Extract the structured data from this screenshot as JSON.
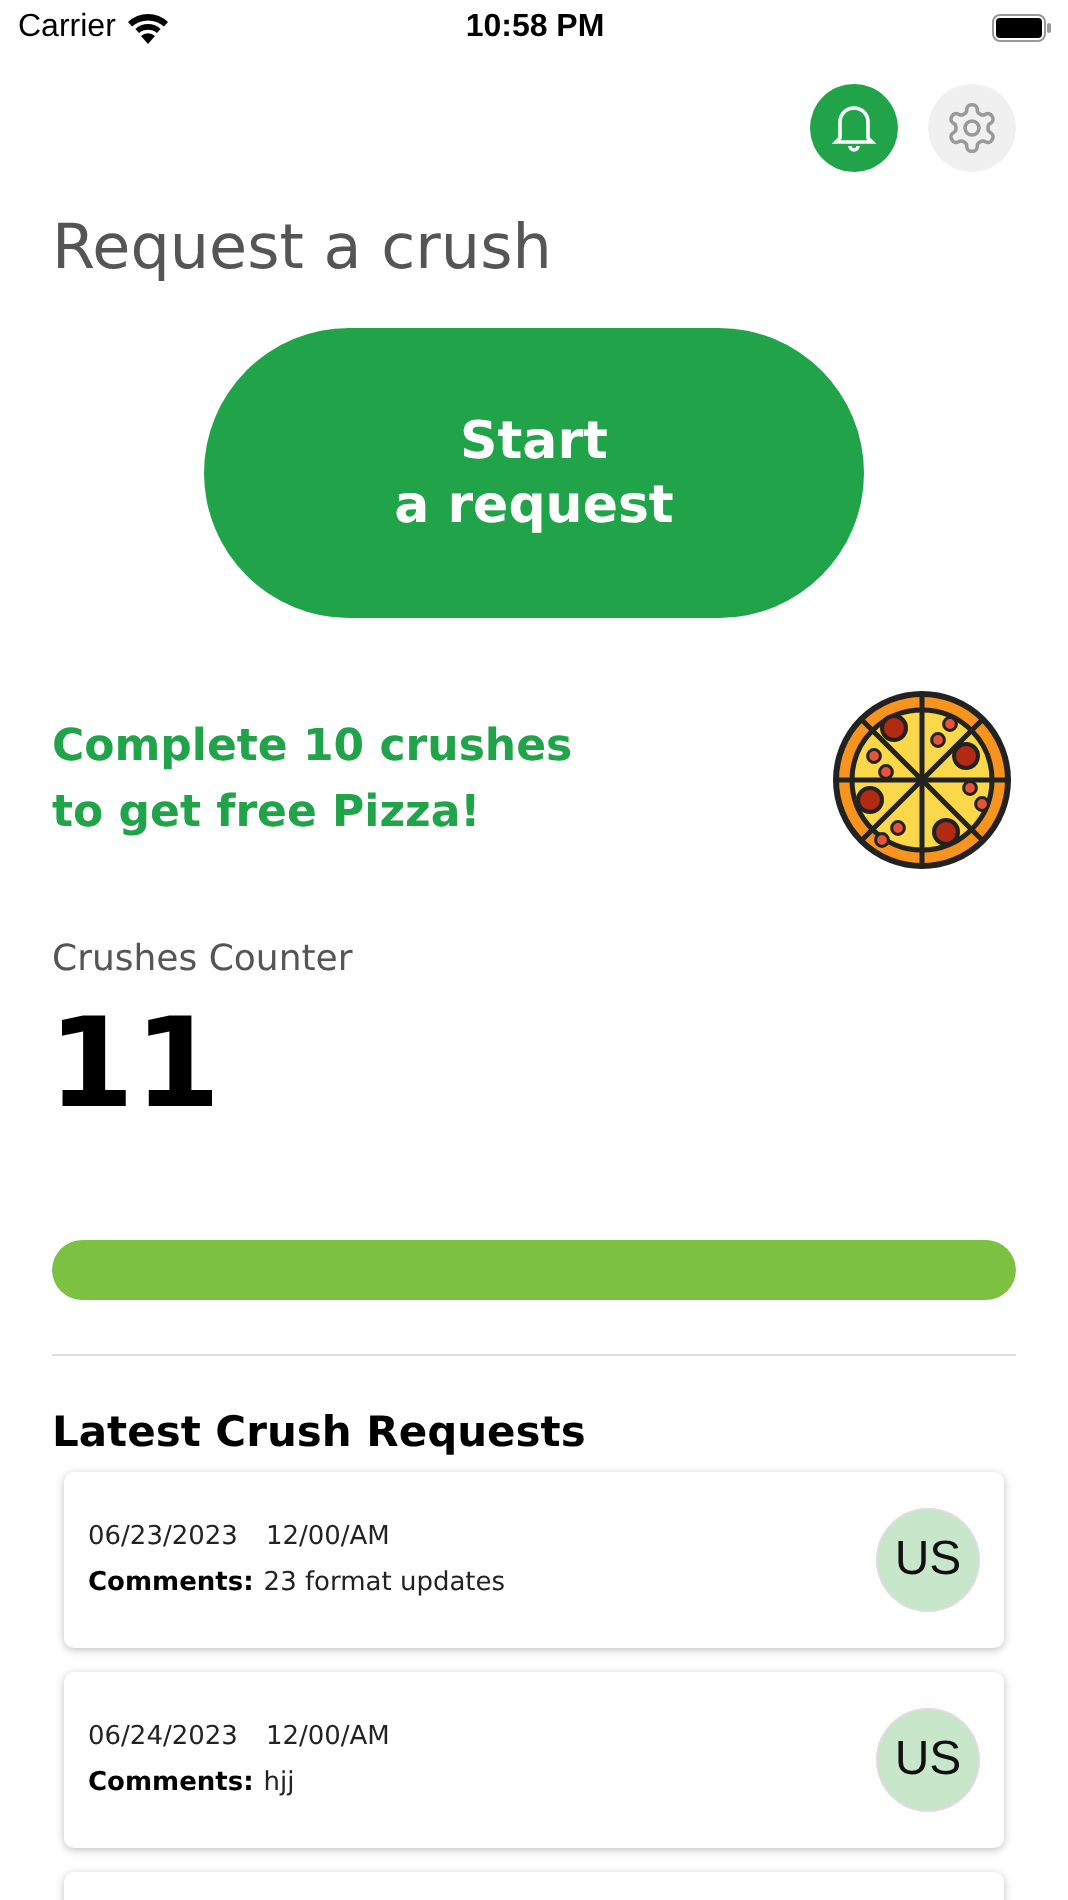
{
  "status_bar": {
    "carrier": "Carrier",
    "time": "10:58 PM"
  },
  "header": {
    "notifications_active": true
  },
  "title": "Request a crush",
  "start_button": {
    "label_lines": [
      "Start",
      "a request"
    ]
  },
  "promo": {
    "lines": [
      "Complete 10 crushes",
      "to get free Pizza!"
    ]
  },
  "counter": {
    "label": "Crushes Counter",
    "value": "11",
    "level": 1
  },
  "requests": {
    "heading": "Latest Crush Requests",
    "items": [
      {
        "kind": "request",
        "date": "06/23/2023",
        "time": "12/00/AM",
        "comments_label": "Comments:",
        "comments": "23 format updates",
        "avatar": "US"
      },
      {
        "kind": "request",
        "date": "06/24/2023",
        "time": "12/00/AM",
        "comments_label": "Comments:",
        "comments": "hjj",
        "avatar": "US"
      },
      {
        "kind": "cut"
      }
    ]
  }
}
